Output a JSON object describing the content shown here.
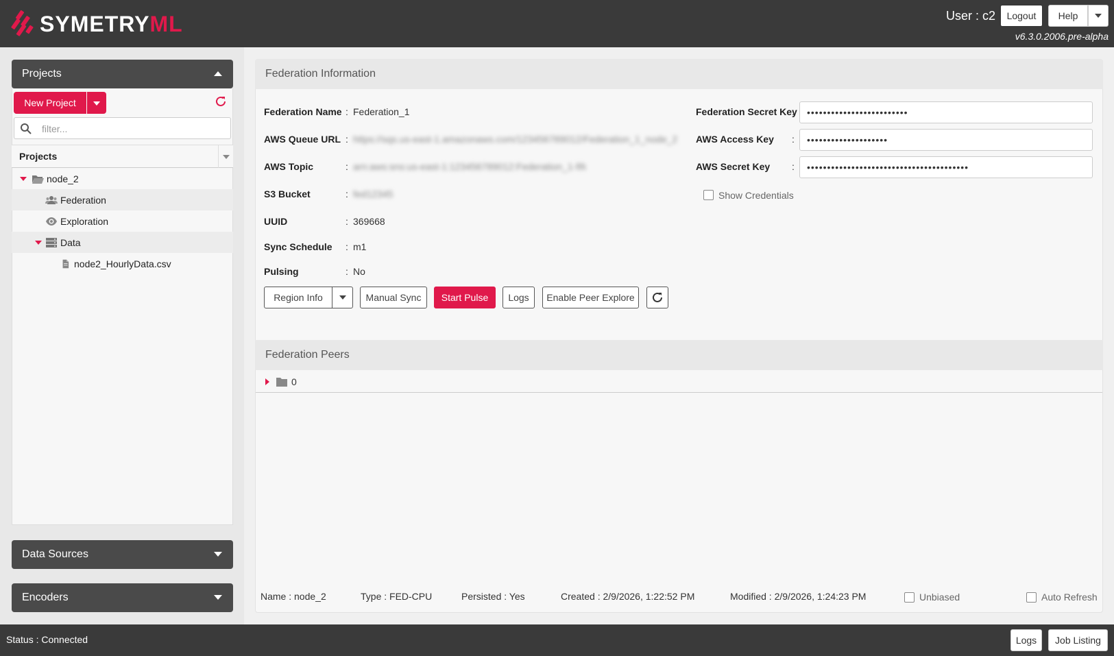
{
  "app": {
    "logo_text_main": "SYMETRY",
    "logo_text_accent": "ML",
    "user_label": "User : c2",
    "logout_label": "Logout",
    "help_label": "Help",
    "version": "v6.3.0.2006.pre-alpha"
  },
  "sidebar": {
    "projects_title": "Projects",
    "new_project_label": "New Project",
    "filter_placeholder": "filter...",
    "tree_column_header": "Projects",
    "tree": [
      {
        "label": "node_2",
        "icon": "folder-open-icon",
        "expanded": true
      },
      {
        "label": "Federation",
        "icon": "users-icon"
      },
      {
        "label": "Exploration",
        "icon": "eye-icon"
      },
      {
        "label": "Data",
        "icon": "database-icon",
        "expanded": true
      },
      {
        "label": "node2_HourlyData.csv",
        "icon": "file-icon"
      }
    ],
    "data_sources_title": "Data Sources",
    "encoders_title": "Encoders"
  },
  "federation": {
    "section_title": "Federation Information",
    "fields": [
      {
        "label": "Federation Name",
        "value": "Federation_1",
        "blurred": false
      },
      {
        "label": "AWS Queue URL",
        "value": "https://sqs.us-east-1.amazonaws.com/123456789012/Federation_1_node_2",
        "blurred": true
      },
      {
        "label": "AWS Topic",
        "value": "arn:aws:sns:us-east-1:123456789012:Federation_1-fifo",
        "blurred": true
      },
      {
        "label": "S3 Bucket",
        "value": "fed12345",
        "blurred": true
      },
      {
        "label": "UUID",
        "value": "369668",
        "blurred": false
      },
      {
        "label": "Sync Schedule",
        "value": "m1",
        "blurred": false
      },
      {
        "label": "Pulsing",
        "value": "No",
        "blurred": false
      }
    ],
    "credentials": [
      {
        "label": "Federation Secret Key",
        "masked": "•••••••••••••••••••••••••"
      },
      {
        "label": "AWS Access Key",
        "masked": "••••••••••••••••••••"
      },
      {
        "label": "AWS Secret Key",
        "masked": "••••••••••••••••••••••••••••••••••••••••"
      }
    ],
    "show_credentials_label": "Show Credentials",
    "buttons": {
      "region_info": "Region Info",
      "manual_sync": "Manual Sync",
      "start_pulse": "Start Pulse",
      "logs": "Logs",
      "enable_peer_explore": "Enable Peer Explore"
    }
  },
  "peers": {
    "section_title": "Federation Peers",
    "root_label": "0"
  },
  "footer": {
    "name": "Name : node_2",
    "type": "Type : FED-CPU",
    "persisted": "Persisted : Yes",
    "created": "Created : 2/9/2026, 1:22:52 PM",
    "modified": "Modified : 2/9/2026, 1:24:23 PM",
    "unbiased_label": "Unbiased",
    "auto_refresh_label": "Auto Refresh"
  },
  "statusbar": {
    "status": "Status : Connected",
    "logs_label": "Logs",
    "job_listing_label": "Job Listing"
  },
  "colors": {
    "accent": "#e0194b",
    "header_bg": "#3a3a3a",
    "panel_bar": "#4a4a4a"
  }
}
